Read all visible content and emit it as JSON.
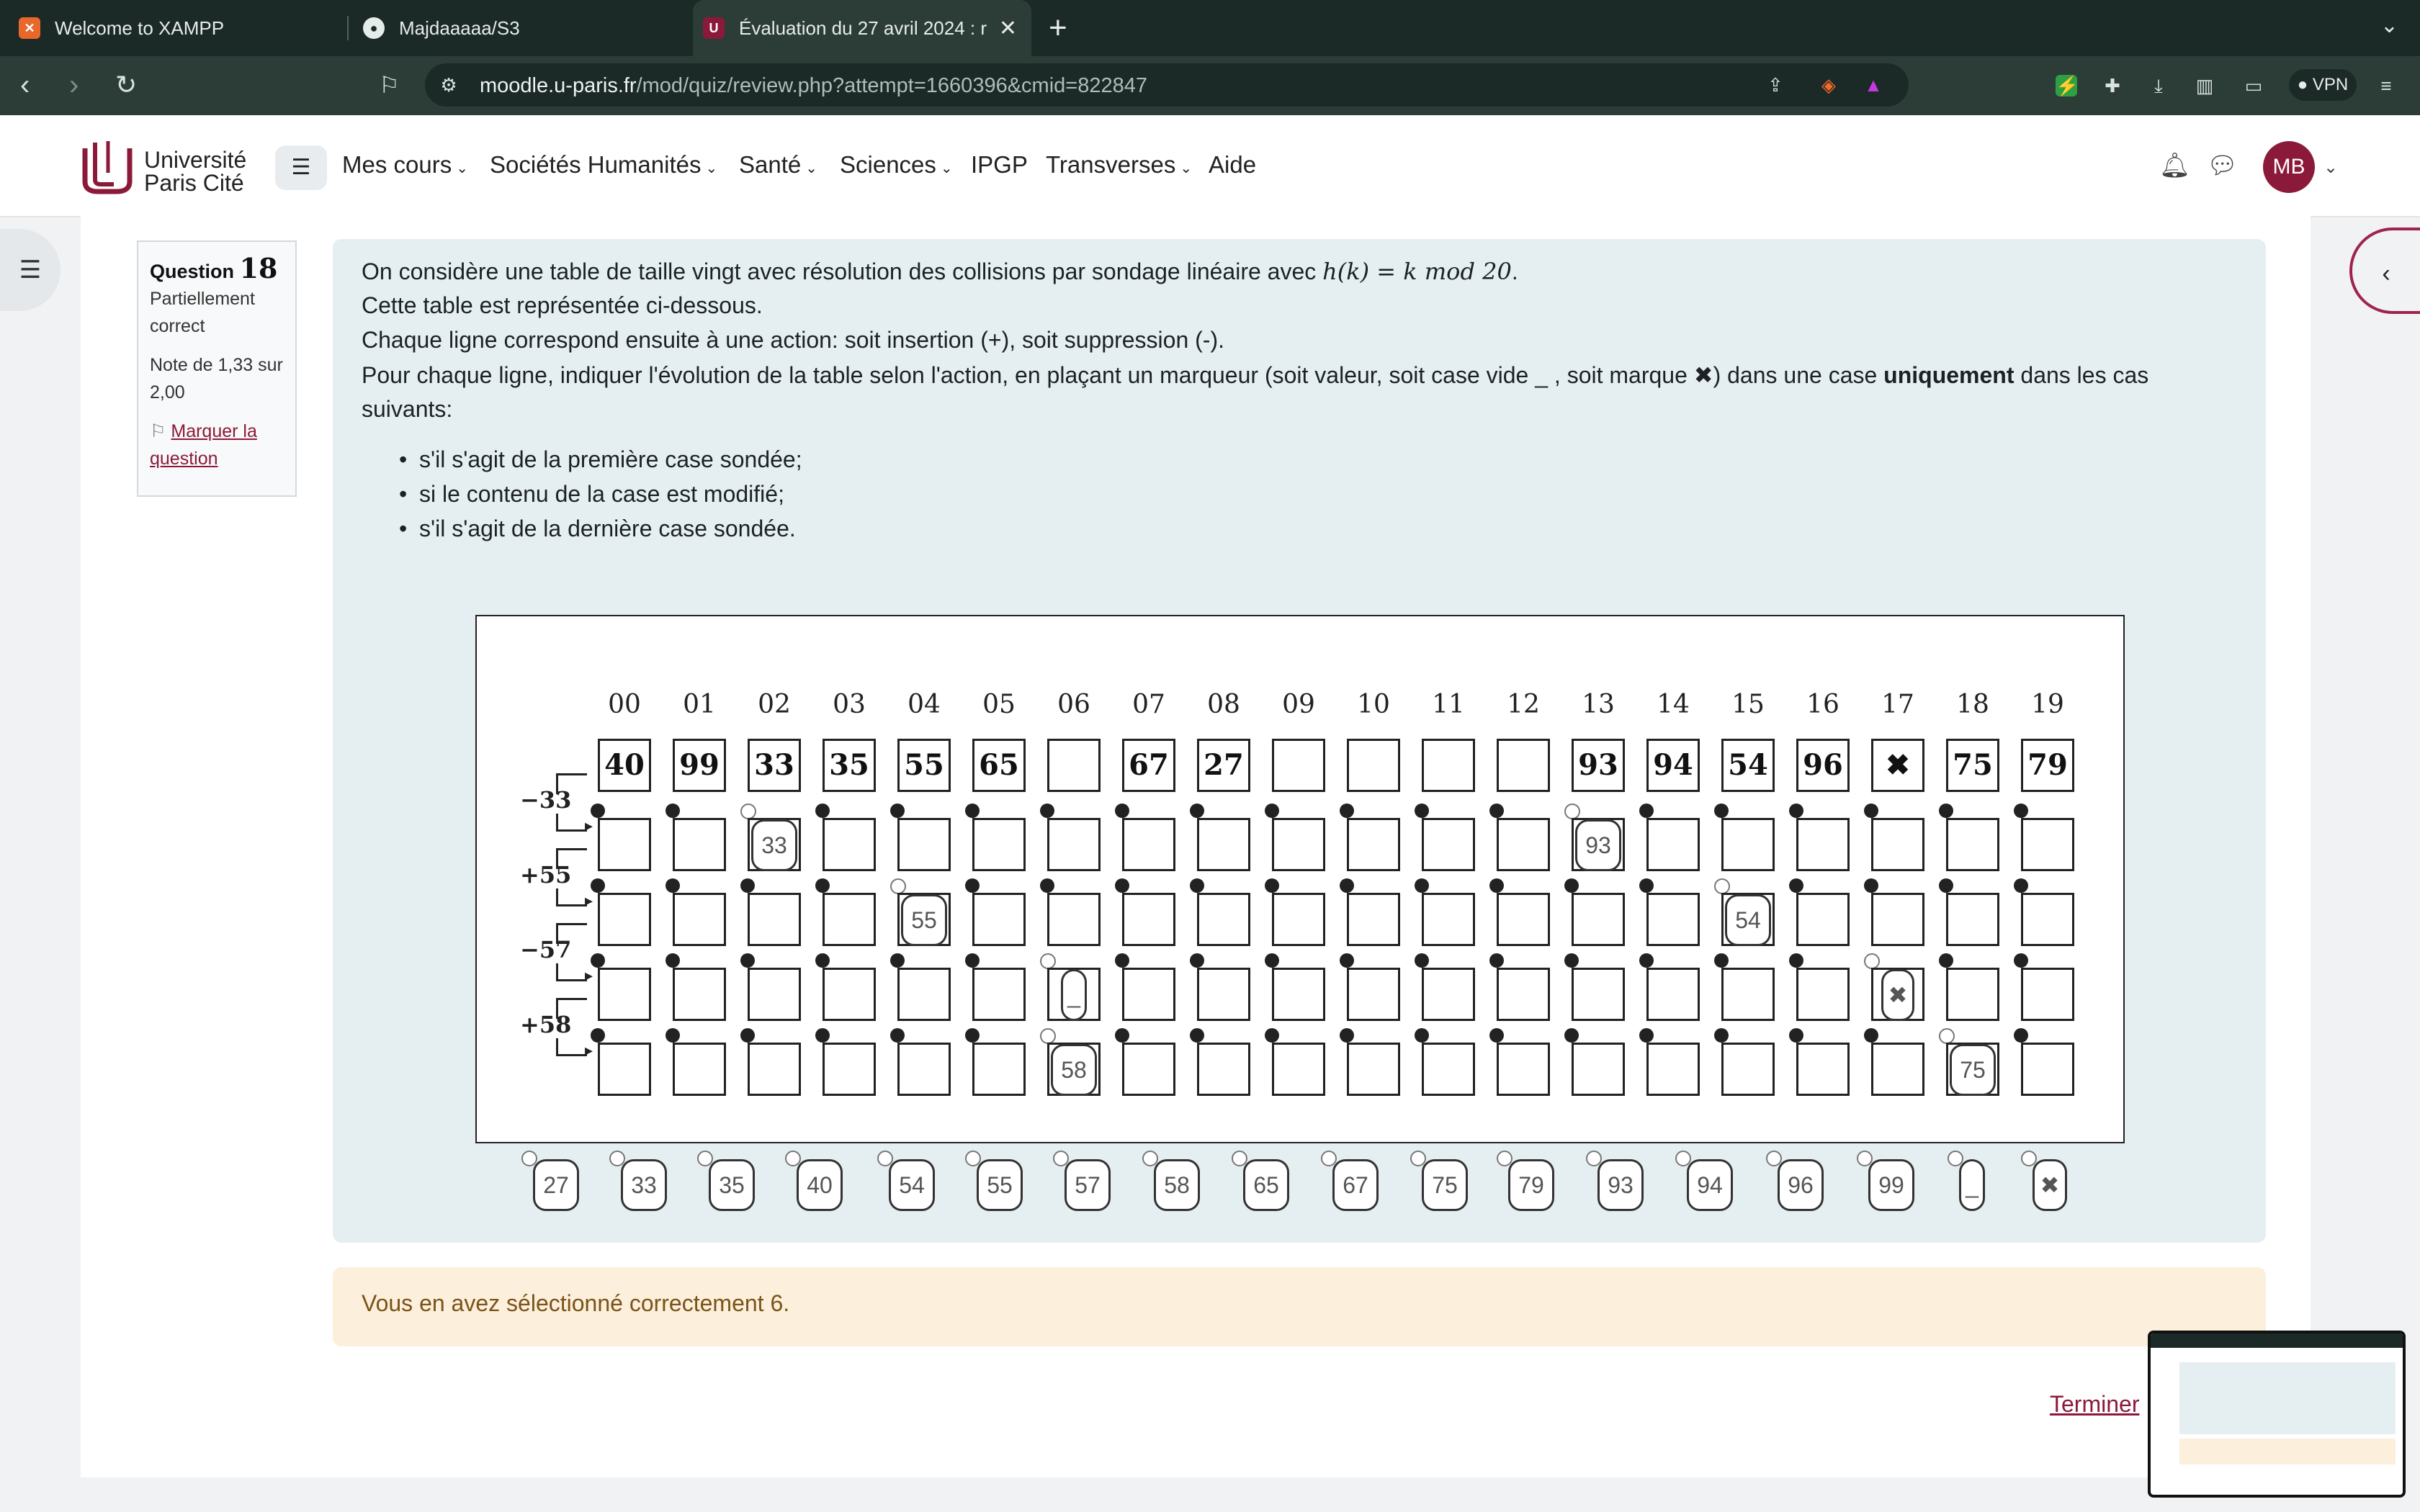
{
  "browser": {
    "tabs": [
      {
        "title": "Welcome to XAMPP",
        "favicon": "xampp-icon"
      },
      {
        "title": "Majdaaaaa/S3",
        "favicon": "github-icon"
      },
      {
        "title": "Évaluation du 27 avril 2024 : r",
        "favicon": "moodle-icon",
        "active": true
      }
    ],
    "url_host": "moodle.u-paris.fr",
    "url_path": "/mod/quiz/review.php?attempt=1660396&cmid=822847",
    "vpn_label": "VPN"
  },
  "site": {
    "logo_line1": "Université",
    "logo_line2": "Paris Cité",
    "nav": [
      "Mes cours",
      "Sociétés Humanités",
      "Santé",
      "Sciences",
      "IPGP",
      "Transverses",
      "Aide"
    ],
    "avatar_initials": "MB",
    "brand_color": "#8b1a3a"
  },
  "question_info": {
    "label": "Question",
    "number": "18",
    "state": "Partiellement correct",
    "grade": "Note de 1,33 sur 2,00",
    "flag_label": "Marquer la question"
  },
  "question": {
    "p1_before": "On considère une table de taille vingt avec résolution des collisions par sondage linéaire avec ",
    "p1_math": "h(k) = k  mod  20",
    "p1_after": ".",
    "p2": "Cette table est représentée ci-dessous.",
    "p3": "Chaque ligne correspond ensuite à une action: soit insertion (+), soit suppression (-).",
    "p4_before": "Pour chaque ligne, indiquer l'évolution de la table selon l'action, en plaçant un marqueur (soit valeur, soit case vide _ , soit marque ✖) dans une case ",
    "p4_bold": "uniquement",
    "p4_after": " dans les cas",
    "p5": "suivants:",
    "bullets": [
      "s'il s'agit de la première case sondée;",
      "si le contenu de la case est modifié;",
      "s'il s'agit de la dernière case sondée."
    ]
  },
  "table": {
    "indices": [
      "00",
      "01",
      "02",
      "03",
      "04",
      "05",
      "06",
      "07",
      "08",
      "09",
      "10",
      "11",
      "12",
      "13",
      "14",
      "15",
      "16",
      "17",
      "18",
      "19"
    ],
    "values": [
      "40",
      "99",
      "33",
      "35",
      "55",
      "65",
      "",
      "67",
      "27",
      "",
      "",
      "",
      "",
      "93",
      "94",
      "54",
      "96",
      "✖",
      "75",
      "79"
    ],
    "actions": [
      "−33",
      "+55",
      "−57",
      "+58"
    ],
    "placed": [
      [
        {
          "col": 2,
          "text": "33"
        },
        {
          "col": 13,
          "text": "93"
        }
      ],
      [
        {
          "col": 4,
          "text": "55"
        },
        {
          "col": 15,
          "text": "54"
        }
      ],
      [
        {
          "col": 6,
          "text": "_"
        },
        {
          "col": 17,
          "text": "✖"
        }
      ],
      [
        {
          "col": 6,
          "text": "58"
        },
        {
          "col": 18,
          "text": "75"
        }
      ]
    ]
  },
  "tokens": [
    "27",
    "33",
    "35",
    "40",
    "54",
    "55",
    "57",
    "58",
    "65",
    "67",
    "75",
    "79",
    "93",
    "94",
    "96",
    "99",
    "_",
    "✖"
  ],
  "feedback": "Vous en avez sélectionné correctement 6.",
  "finish_label": "Terminer"
}
